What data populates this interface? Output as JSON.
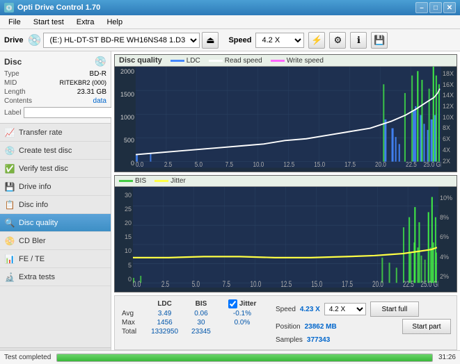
{
  "app": {
    "title": "Opti Drive Control 1.70",
    "icon": "💿"
  },
  "titlebar": {
    "minimize_label": "–",
    "maximize_label": "□",
    "close_label": "✕"
  },
  "menu": {
    "items": [
      "File",
      "Start test",
      "Extra",
      "Help"
    ]
  },
  "toolbar": {
    "drive_label": "Drive",
    "drive_value": "(E:)  HL-DT-ST BD-RE  WH16NS48 1.D3",
    "speed_label": "Speed",
    "speed_value": "4.2 X"
  },
  "disc": {
    "title": "Disc",
    "type_label": "Type",
    "type_value": "BD-R",
    "mid_label": "MID",
    "mid_value": "RITEKBR2 (000)",
    "length_label": "Length",
    "length_value": "23.31 GB",
    "contents_label": "Contents",
    "contents_value": "data",
    "label_label": "Label",
    "label_value": ""
  },
  "nav": {
    "items": [
      {
        "id": "transfer-rate",
        "label": "Transfer rate",
        "icon": "📈"
      },
      {
        "id": "create-test-disc",
        "label": "Create test disc",
        "icon": "💿"
      },
      {
        "id": "verify-test-disc",
        "label": "Verify test disc",
        "icon": "✅"
      },
      {
        "id": "drive-info",
        "label": "Drive info",
        "icon": "💾"
      },
      {
        "id": "disc-info",
        "label": "Disc info",
        "icon": "📋"
      },
      {
        "id": "disc-quality",
        "label": "Disc quality",
        "icon": "🔍",
        "active": true
      },
      {
        "id": "cd-bler",
        "label": "CD Bler",
        "icon": "📀"
      },
      {
        "id": "fe-te",
        "label": "FE / TE",
        "icon": "📊"
      },
      {
        "id": "extra-tests",
        "label": "Extra tests",
        "icon": "🔬"
      }
    ]
  },
  "status_window": {
    "label": "Status window >>",
    "completed": "Test completed"
  },
  "chart1": {
    "title": "Disc quality",
    "legend": [
      {
        "label": "LDC",
        "color": "#4488ff"
      },
      {
        "label": "Read speed",
        "color": "#ffffff"
      },
      {
        "label": "Write speed",
        "color": "#ff66ff"
      }
    ],
    "y_left_labels": [
      "2000",
      "1500",
      "1000",
      "500",
      "0"
    ],
    "y_right_labels": [
      "18X",
      "16X",
      "14X",
      "12X",
      "10X",
      "8X",
      "6X",
      "4X",
      "2X"
    ],
    "x_labels": [
      "0.0",
      "2.5",
      "5.0",
      "7.5",
      "10.0",
      "12.5",
      "15.0",
      "17.5",
      "20.0",
      "22.5",
      "25.0 GB"
    ]
  },
  "chart2": {
    "legend": [
      {
        "label": "BIS",
        "color": "#44cc44"
      },
      {
        "label": "Jitter",
        "color": "#ffff44"
      }
    ],
    "y_left_labels": [
      "30",
      "25",
      "20",
      "15",
      "10",
      "5",
      "0"
    ],
    "y_right_labels": [
      "10%",
      "8%",
      "6%",
      "4%",
      "2%"
    ],
    "x_labels": [
      "0.0",
      "2.5",
      "5.0",
      "7.5",
      "10.0",
      "12.5",
      "15.0",
      "17.5",
      "20.0",
      "22.5",
      "25.0 GB"
    ]
  },
  "stats": {
    "headers": [
      "LDC",
      "BIS"
    ],
    "jitter_label": "Jitter",
    "speed_label": "Speed",
    "speed_value": "4.23 X",
    "speed_select": "4.2 X",
    "position_label": "Position",
    "position_value": "23862 MB",
    "samples_label": "Samples",
    "samples_value": "377343",
    "rows": [
      {
        "label": "Avg",
        "ldc": "3.49",
        "bis": "0.06",
        "jitter": "-0.1%"
      },
      {
        "label": "Max",
        "ldc": "1456",
        "bis": "30",
        "jitter": "0.0%"
      },
      {
        "label": "Total",
        "ldc": "1332950",
        "bis": "23345",
        "jitter": ""
      }
    ],
    "start_full_label": "Start full",
    "start_part_label": "Start part"
  },
  "statusbar": {
    "text": "Test completed",
    "progress": 100,
    "time": "31:26"
  }
}
